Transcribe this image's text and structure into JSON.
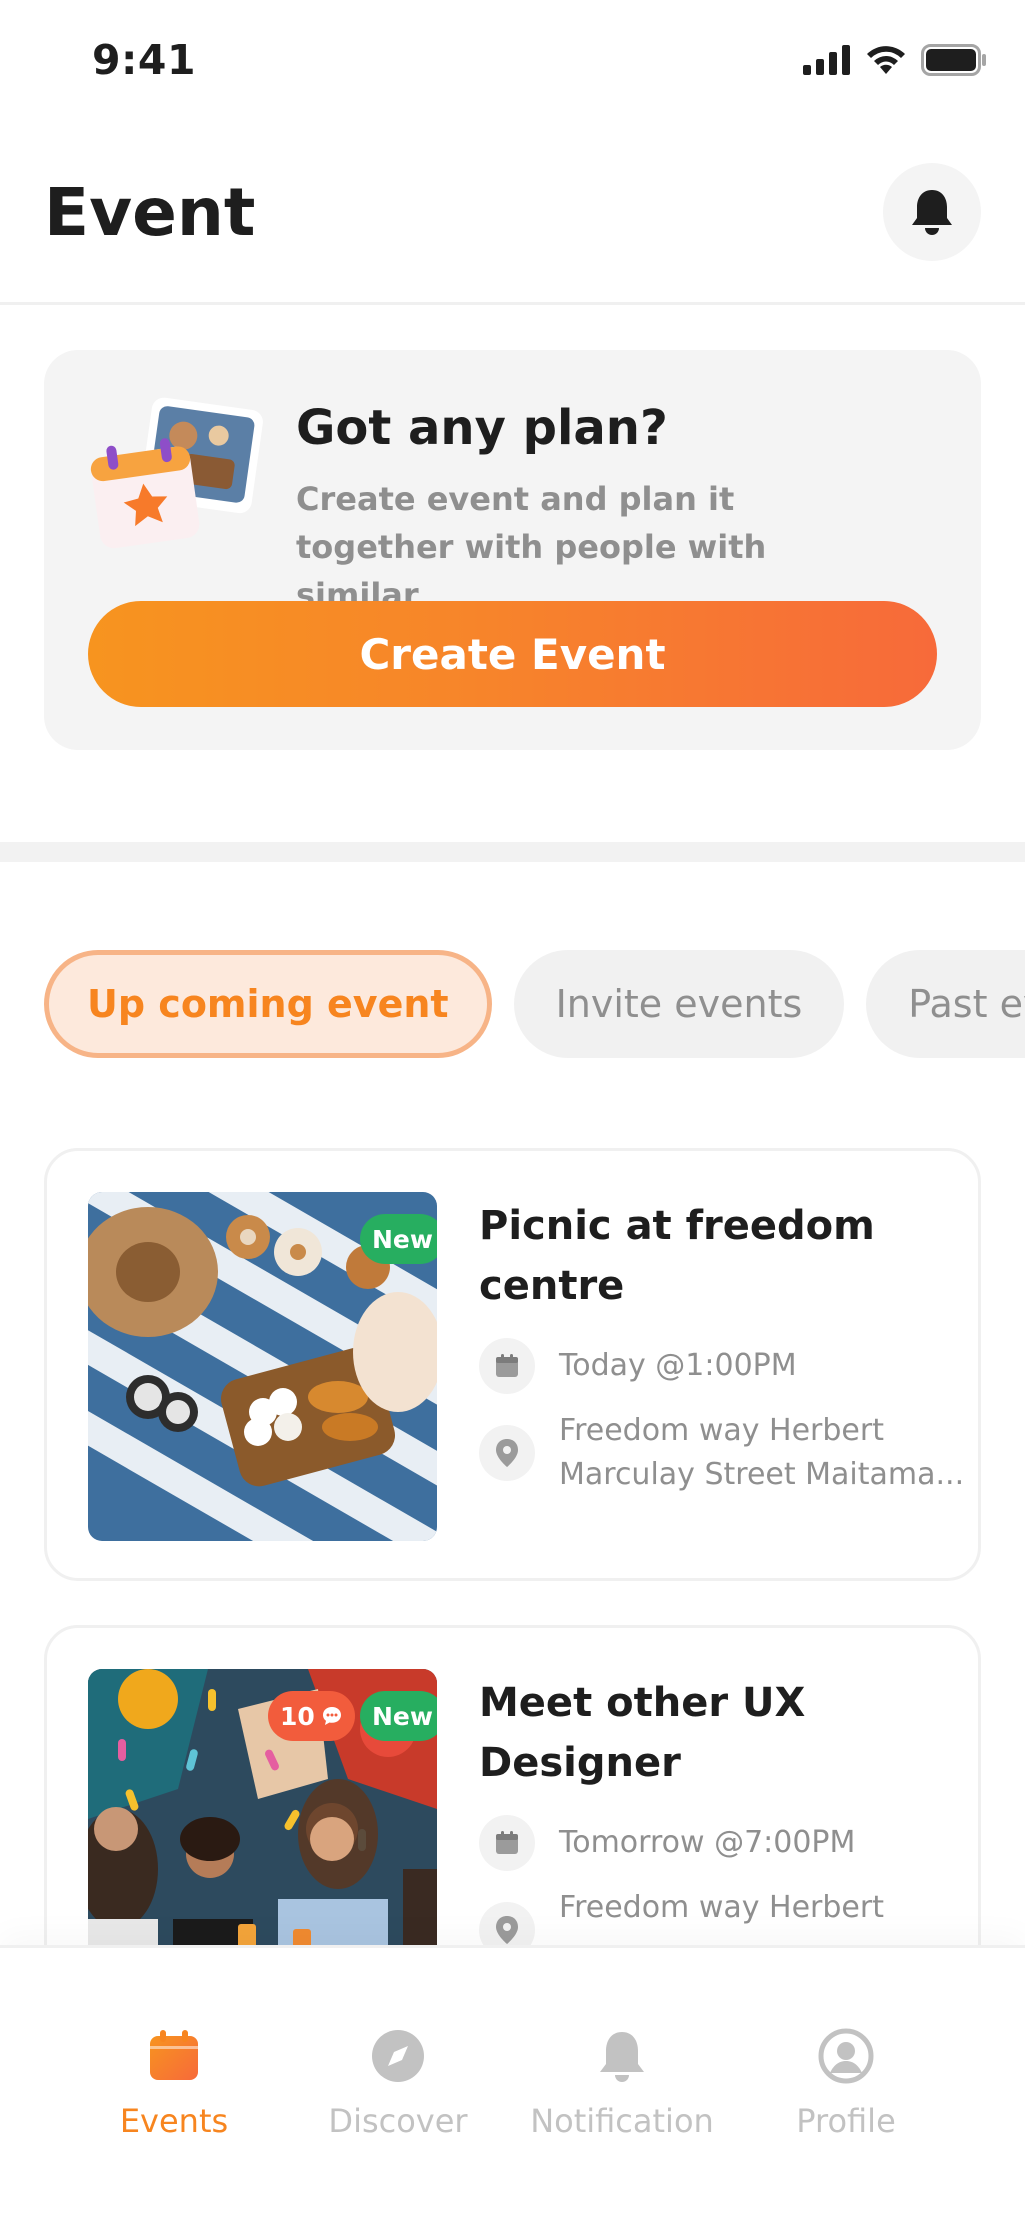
{
  "status_bar": {
    "time": "9:41"
  },
  "header": {
    "title": "Event"
  },
  "promo": {
    "title": "Got any plan?",
    "description": "Create event and plan it together with people with similar",
    "button_label": "Create Event"
  },
  "tabs": [
    {
      "label": "Up coming event",
      "active": true
    },
    {
      "label": "Invite events",
      "active": false
    },
    {
      "label": "Past events",
      "active": false
    }
  ],
  "events": [
    {
      "title": "Picnic at freedom centre",
      "badge_new": "New",
      "date": "Today @1:00PM",
      "location_line1": "Freedom way Herbert",
      "location_line2": "Marculay Street Maitama..."
    },
    {
      "title": "Meet other UX Designer",
      "badge_new": "New",
      "badge_count": "10",
      "date": "Tomorrow @7:00PM",
      "location_line1": "Freedom way Herbert"
    }
  ],
  "bottom_nav": [
    {
      "label": "Events",
      "icon": "calendar-icon",
      "active": true
    },
    {
      "label": "Discover",
      "icon": "compass-icon",
      "active": false
    },
    {
      "label": "Notification",
      "icon": "bell-icon",
      "active": false
    },
    {
      "label": "Profile",
      "icon": "profile-icon",
      "active": false
    }
  ],
  "colors": {
    "accent": "#F7851F",
    "accent_end": "#F76A3A",
    "badge_new": "#27AE60",
    "badge_count": "#F25C3C",
    "muted": "#8F8F8F"
  }
}
